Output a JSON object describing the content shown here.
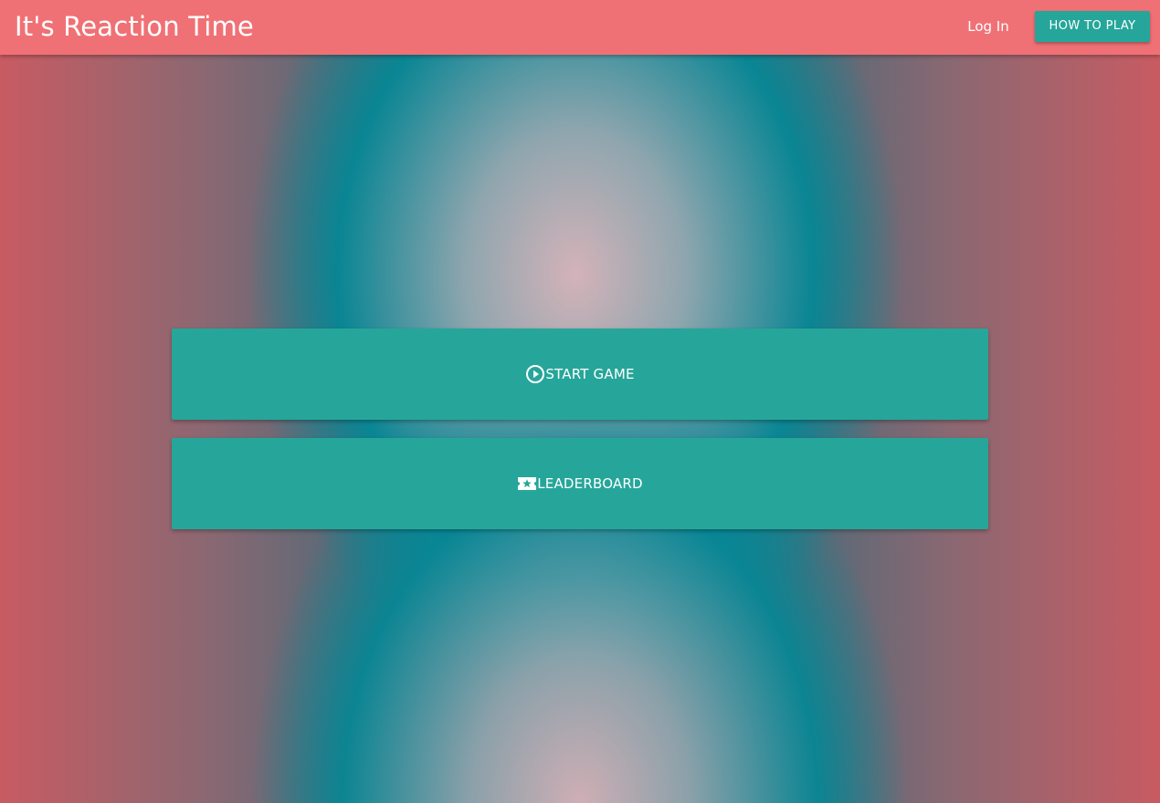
{
  "header": {
    "title": "It's Reaction Time",
    "login_label": "Log In",
    "howto_label": "HOW TO PLAY"
  },
  "main": {
    "start_label": "START GAME",
    "start_icon": "play-circle-icon",
    "leaderboard_label": "LEADERBOARD",
    "leaderboard_icon": "star-ticket-icon"
  },
  "colors": {
    "appbar": "#f07175",
    "accent": "#26a69a",
    "background_teal": "#088694",
    "background_pink": "#c85b62"
  }
}
